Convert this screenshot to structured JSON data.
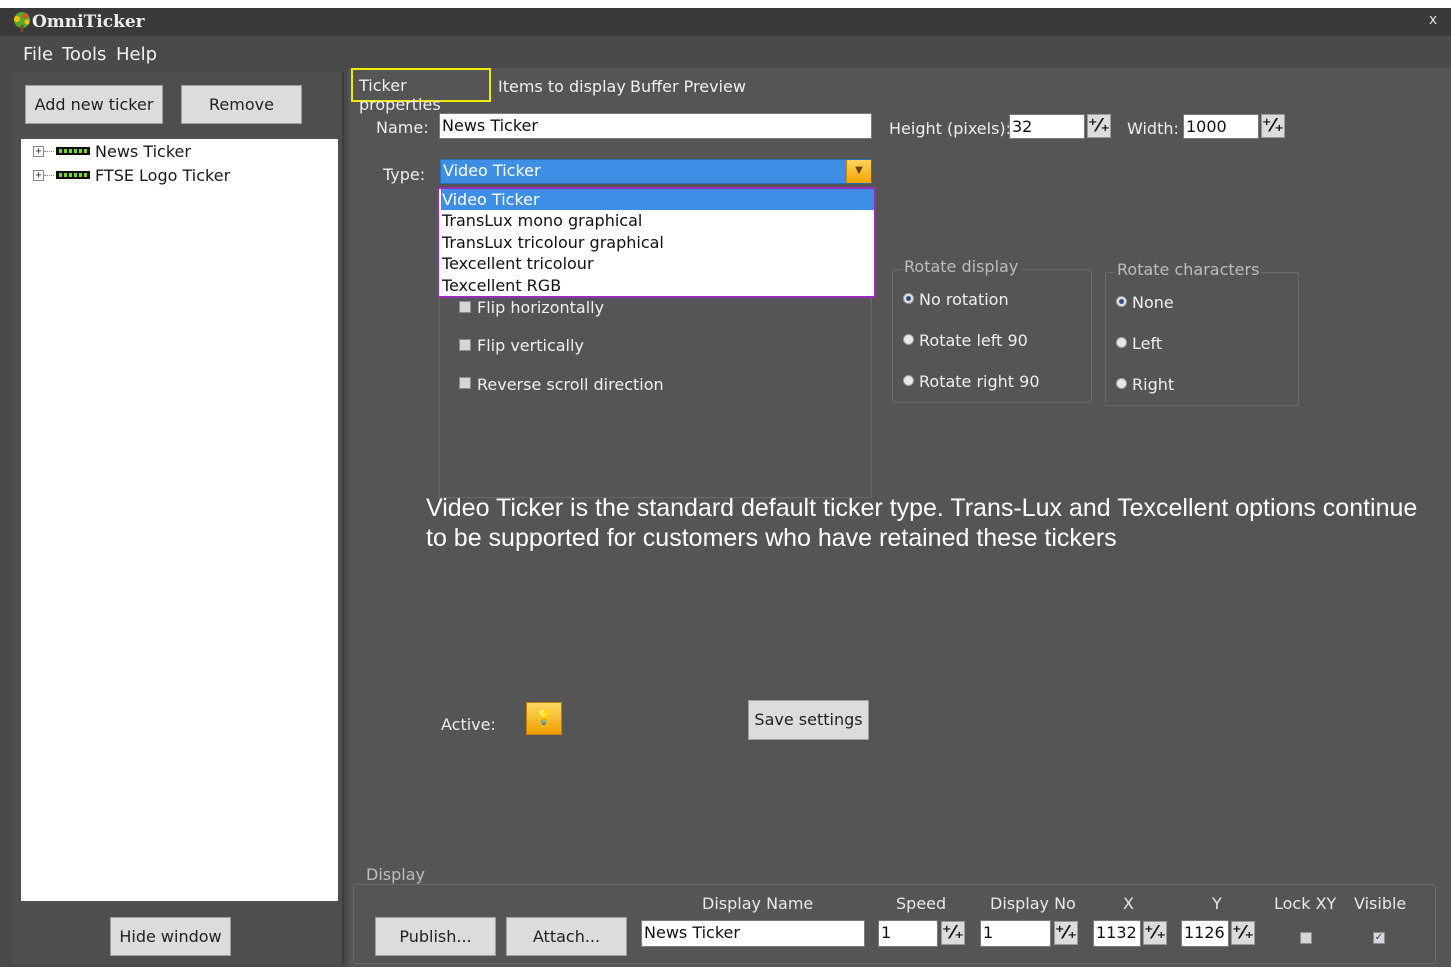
{
  "window": {
    "title": "OmniTicker",
    "close_glyph": "x",
    "logo_icon": "omniticker-tree-logo-icon"
  },
  "menu": [
    "File",
    "Tools",
    "Help"
  ],
  "left_pane": {
    "add_label": "Add new ticker",
    "remove_label": "Remove",
    "tree": [
      {
        "expander": "+",
        "label": "News Ticker"
      },
      {
        "expander": "+",
        "label": "FTSE Logo Ticker"
      }
    ],
    "hide_label": "Hide window"
  },
  "tabs": [
    "Ticker properties",
    "Items to display",
    "Buffer Preview"
  ],
  "properties": {
    "name_label": "Name:",
    "name_value": "News Ticker",
    "height_label": "Height (pixels):",
    "height_value": "32",
    "width_label": "Width:",
    "width_value": "1000",
    "type_label": "Type:",
    "type_value": "Video Ticker",
    "type_options": [
      "Video Ticker",
      "TransLux mono graphical",
      "TransLux tricolour graphical",
      "Texcellent tricolour",
      "Texcellent RGB"
    ],
    "flip": {
      "horizontal": "Flip horizontally",
      "vertical": "Flip vertically",
      "reverse": "Reverse scroll direction"
    },
    "rotate_display": {
      "title": "Rotate display",
      "options": [
        "No rotation",
        "Rotate left 90",
        "Rotate right 90"
      ],
      "selected": "No rotation"
    },
    "rotate_characters": {
      "title": "Rotate characters",
      "options": [
        "None",
        "Left",
        "Right"
      ],
      "selected": "None"
    },
    "info": "Video Ticker is the standard default ticker type. Trans-Lux and Texcellent options continue to be supported for customers who have retained these tickers",
    "active_label": "Active:",
    "active_icon": "lightbulb-icon",
    "save_label": "Save settings"
  },
  "display": {
    "title": "Display",
    "publish_label": "Publish...",
    "attach_label": "Attach...",
    "headers": {
      "display_name": "Display Name",
      "speed": "Speed",
      "display_no": "Display No",
      "x": "X",
      "y": "Y",
      "lock_xy": "Lock XY",
      "visible": "Visible"
    },
    "values": {
      "display_name": "News Ticker",
      "speed": "1",
      "display_no": "1",
      "x": "1132",
      "y": "1126",
      "lock_xy": false,
      "visible": true
    }
  },
  "colors": {
    "highlight_tab_border": "#f0ea00",
    "dropdown_border": "#9b2bb8",
    "selection_blue": "#3e8ee6",
    "panel_bg": "#555555"
  }
}
